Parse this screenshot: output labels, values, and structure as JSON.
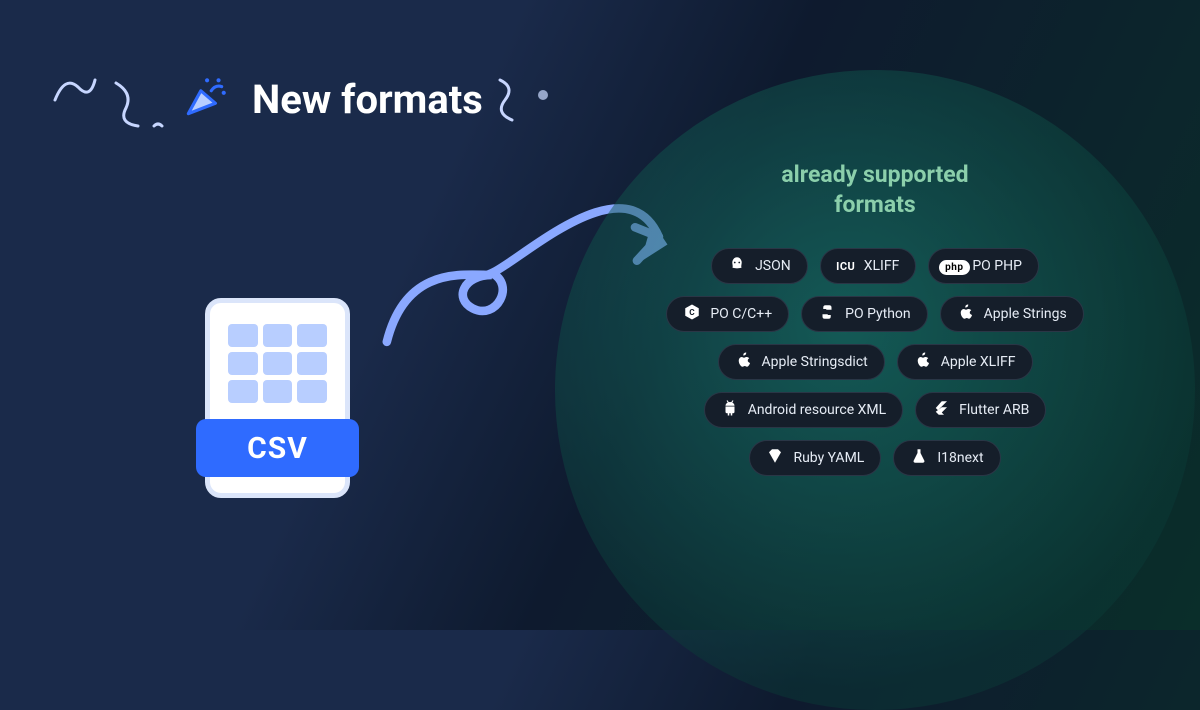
{
  "header": {
    "title": "New formats"
  },
  "new_format": {
    "label": "CSV"
  },
  "supported": {
    "title_line1": "already supported",
    "title_line2": "formats",
    "pills": [
      {
        "name": "json",
        "label": "JSON",
        "icon": "blob-icon"
      },
      {
        "name": "xliff",
        "label": "XLIFF",
        "icon": "icu-text-icon"
      },
      {
        "name": "po-php",
        "label": "PO PHP",
        "icon": "php-badge-icon"
      },
      {
        "name": "po-c",
        "label": "PO C/C++",
        "icon": "hex-c-icon"
      },
      {
        "name": "po-python",
        "label": "PO Python",
        "icon": "python-icon"
      },
      {
        "name": "apple-strings",
        "label": "Apple Strings",
        "icon": "apple-icon"
      },
      {
        "name": "apple-stringsdict",
        "label": "Apple Stringsdict",
        "icon": "apple-icon"
      },
      {
        "name": "apple-xliff",
        "label": "Apple XLIFF",
        "icon": "apple-icon"
      },
      {
        "name": "android-xml",
        "label": "Android resource XML",
        "icon": "android-icon"
      },
      {
        "name": "flutter-arb",
        "label": "Flutter ARB",
        "icon": "flutter-icon"
      },
      {
        "name": "ruby-yaml",
        "label": "Ruby YAML",
        "icon": "ruby-icon"
      },
      {
        "name": "i18next",
        "label": "I18next",
        "icon": "flask-icon"
      }
    ],
    "rows": [
      [
        0,
        1,
        2
      ],
      [
        3,
        4,
        5
      ],
      [
        6,
        7
      ],
      [
        8,
        9
      ],
      [
        10,
        11
      ]
    ]
  }
}
